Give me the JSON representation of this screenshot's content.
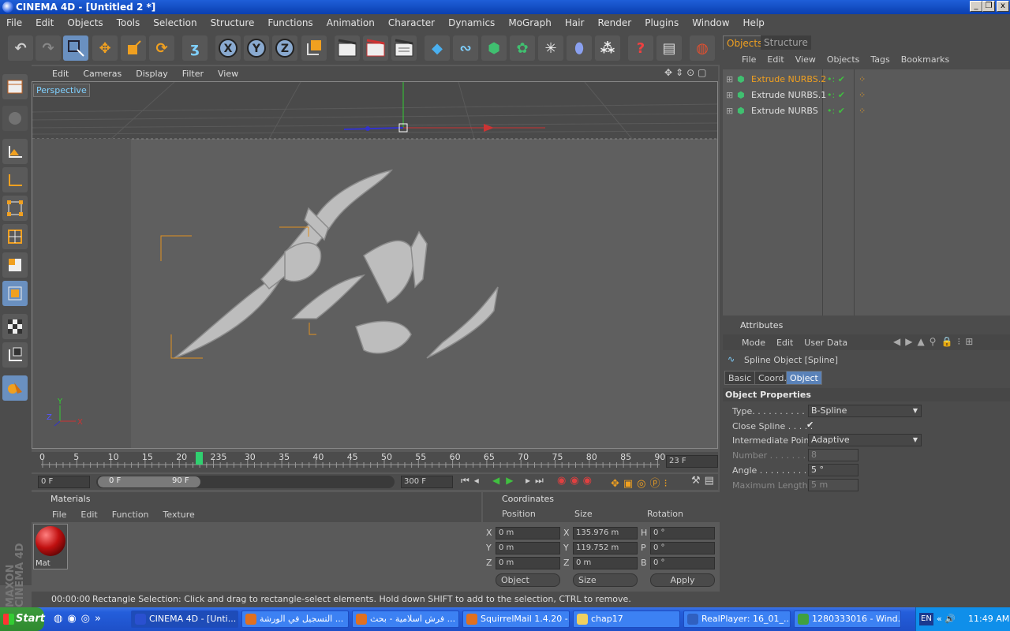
{
  "window": {
    "title": "CINEMA 4D - [Untitled 2 *]",
    "btn_min": "_",
    "btn_max": "❐",
    "btn_close": "x"
  },
  "menu": [
    "File",
    "Edit",
    "Objects",
    "Tools",
    "Selection",
    "Structure",
    "Functions",
    "Animation",
    "Character",
    "Dynamics",
    "MoGraph",
    "Hair",
    "Render",
    "Plugins",
    "Window",
    "Help"
  ],
  "toolbar": {
    "x_label": "X",
    "y_label": "Y",
    "z_label": "Z"
  },
  "viewport": {
    "menu": [
      "Edit",
      "Cameras",
      "Display",
      "Filter",
      "View"
    ],
    "label": "Perspective",
    "axis_x": "X",
    "axis_y": "Y",
    "axis_z": "Z"
  },
  "timeline": {
    "ticks": [
      "0",
      "5",
      "10",
      "15",
      "20",
      "235",
      "30",
      "35",
      "40",
      "45",
      "50",
      "55",
      "60",
      "65",
      "70",
      "75",
      "80",
      "85",
      "90"
    ],
    "current_frame": "23 F",
    "start_field": "0 F",
    "range_start": "0 F",
    "range_end": "90 F",
    "end_field": "300 F"
  },
  "materials": {
    "title": "Materials",
    "menu": [
      "File",
      "Edit",
      "Function",
      "Texture"
    ],
    "items": [
      {
        "name": "Mat",
        "color": "#c01010"
      }
    ]
  },
  "coordinates": {
    "title": "Coordinates",
    "headers": [
      "Position",
      "Size",
      "Rotation"
    ],
    "rows": [
      {
        "axis": "X",
        "pos": "0 m",
        "size_axis": "X",
        "size": "135.976 m",
        "rot_axis": "H",
        "rot": "0 °"
      },
      {
        "axis": "Y",
        "pos": "0 m",
        "size_axis": "Y",
        "size": "119.752 m",
        "rot_axis": "P",
        "rot": "0 °"
      },
      {
        "axis": "Z",
        "pos": "0 m",
        "size_axis": "Z",
        "size": "0 m",
        "rot_axis": "B",
        "rot": "0 °"
      }
    ],
    "mode_select": "Object",
    "size_select": "Size",
    "apply": "Apply"
  },
  "objects": {
    "tabs": [
      "Objects",
      "Structure"
    ],
    "menu": [
      "File",
      "Edit",
      "View",
      "Objects",
      "Tags",
      "Bookmarks"
    ],
    "items": [
      {
        "name": "Extrude NURBS.2",
        "selected": true
      },
      {
        "name": "Extrude NURBS.1",
        "selected": false
      },
      {
        "name": "Extrude NURBS",
        "selected": false
      }
    ]
  },
  "attributes": {
    "title": "Attributes",
    "menu": [
      "Mode",
      "Edit",
      "User Data"
    ],
    "object_label": "Spline Object [Spline]",
    "tabs": [
      "Basic",
      "Coord.",
      "Object"
    ],
    "section": "Object Properties",
    "props": [
      {
        "label": "Type. . . . . . . . . . .",
        "value": "B-Spline",
        "kind": "select",
        "enabled": true
      },
      {
        "label": "Close Spline . . . . .",
        "value": "✔",
        "kind": "check",
        "enabled": true
      },
      {
        "label": "Intermediate Points",
        "value": "Adaptive",
        "kind": "select",
        "enabled": true
      },
      {
        "label": "Number . . . . . . . .",
        "value": "8",
        "kind": "num",
        "enabled": false
      },
      {
        "label": "Angle . . . . . . . . . .",
        "value": "5 °",
        "kind": "num",
        "enabled": true
      },
      {
        "label": "Maximum Length",
        "value": "5 m",
        "kind": "num",
        "enabled": false
      }
    ]
  },
  "status": {
    "time": "00:00:00",
    "message": "Rectangle Selection: Click and drag to rectangle-select elements. Hold down SHIFT to add to the selection, CTRL to remove."
  },
  "brand": "MAXON CINEMA 4D",
  "taskbar": {
    "start": "Start",
    "tasks": [
      "CINEMA 4D - [Unti...",
      "التسجيل في الورشة ...",
      "فرش اسلامية - بحث ...",
      "SquirrelMail 1.4.20 -...",
      "chap17",
      "RealPlayer: 16_01_...",
      "1280333016 - Wind..."
    ],
    "lang": "EN",
    "clock": "11:49 AM"
  }
}
